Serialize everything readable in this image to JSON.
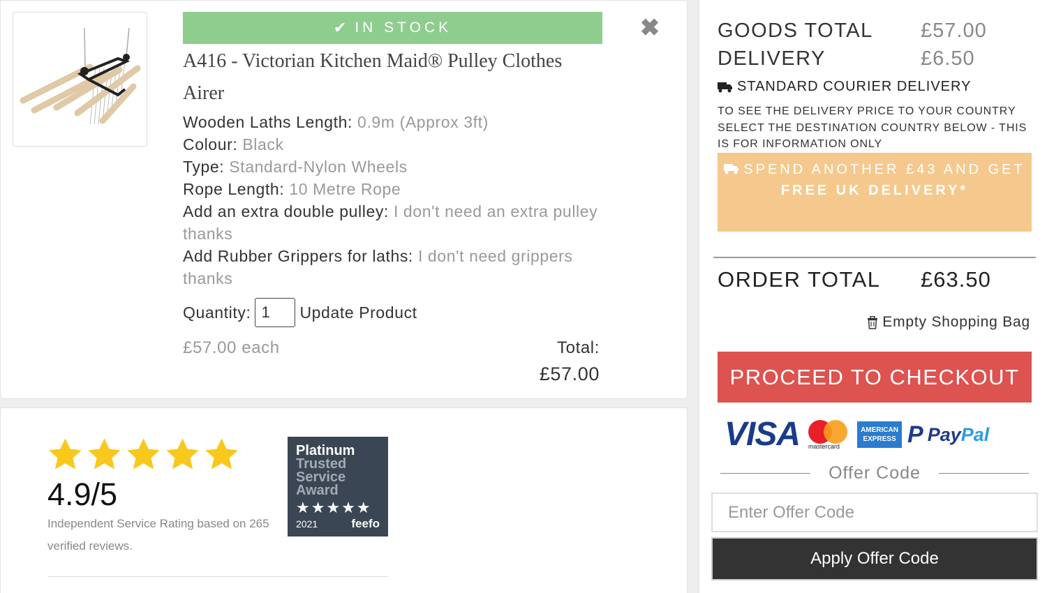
{
  "product": {
    "stock_label": "IN STOCK",
    "title": "A416 - Victorian Kitchen Maid® Pulley Clothes Airer",
    "attributes": [
      {
        "label": "Wooden Laths Length:",
        "value": "0.9m (Approx 3ft)"
      },
      {
        "label": "Colour:",
        "value": "Black"
      },
      {
        "label": "Type:",
        "value": "Standard-Nylon Wheels"
      },
      {
        "label": "Rope Length:",
        "value": "10 Metre Rope"
      },
      {
        "label": "Add an extra double pulley:",
        "value": "I don't need an extra pulley thanks"
      },
      {
        "label": "Add Rubber Grippers for laths:",
        "value": "I don't need grippers thanks"
      }
    ],
    "quantity_label": "Quantity:",
    "quantity_value": "1",
    "update_label": "Update Product",
    "each_price": "£57.00 each",
    "total_label": "Total:",
    "total_value": "£57.00",
    "close_icon": "close-icon"
  },
  "rating": {
    "stars": 5,
    "score": "4.9/5",
    "description": "Independent Service Rating based on 265 verified reviews.",
    "badge": {
      "line1": "Platinum",
      "line2": "Trusted",
      "line3": "Service",
      "line4": "Award",
      "year": "2021",
      "brand": "feefo"
    },
    "star_color": "#f8c81c"
  },
  "summary": {
    "goods_total_label": "GOODS TOTAL",
    "goods_total_value": "£57.00",
    "delivery_label": "DELIVERY",
    "delivery_value": "£6.50",
    "courier_label": "STANDARD COURIER DELIVERY",
    "delivery_info": "TO SEE THE DELIVERY PRICE TO YOUR COUNTRY SELECT THE DESTINATION COUNTRY BELOW - THIS IS FOR INFORMATION ONLY",
    "spend_line1": "SPEND ANOTHER £43 AND GET",
    "spend_line2": "FREE UK DELIVERY*",
    "order_total_label": "ORDER TOTAL",
    "order_total_value": "£63.50",
    "empty_bag_label": "Empty Shopping Bag",
    "checkout_label": "PROCEED TO CHECKOUT",
    "payments": {
      "visa": "VISA",
      "mastercard": "mastercard",
      "amex_line1": "AMERICAN",
      "amex_line2": "EXPRESS",
      "paypal_pay": "Pay",
      "paypal_pal": "Pal"
    },
    "offer_title": "Offer Code",
    "offer_placeholder": "Enter Offer Code",
    "apply_label": "Apply Offer Code"
  },
  "colors": {
    "in_stock": "#8fcd8f",
    "spend_banner": "#f5c98e",
    "checkout": "#dc5350",
    "apply": "#333333"
  }
}
